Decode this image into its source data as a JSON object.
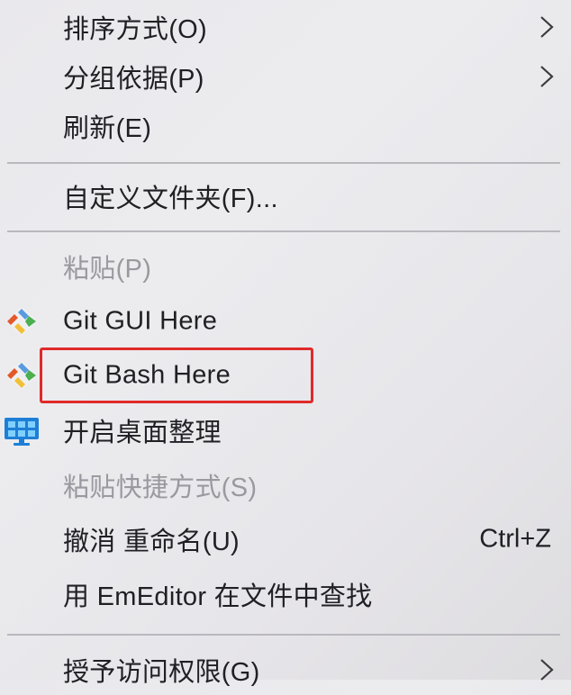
{
  "menu": {
    "items": [
      {
        "label": "排序方式(O)",
        "submenu": true
      },
      {
        "label": "分组依据(P)",
        "submenu": true
      },
      {
        "label": "刷新(E)"
      },
      {
        "label": "自定义文件夹(F)..."
      },
      {
        "label": "粘贴(P)",
        "disabled": true
      },
      {
        "label": "Git GUI Here",
        "icon": "git-icon"
      },
      {
        "label": "Git Bash Here",
        "icon": "git-icon",
        "highlighted": true
      },
      {
        "label": "开启桌面整理",
        "icon": "monitor-icon"
      },
      {
        "label": "粘贴快捷方式(S)",
        "disabled": true
      },
      {
        "label": "撤消 重命名(U)",
        "shortcut": "Ctrl+Z"
      },
      {
        "label": "用 EmEditor 在文件中查找"
      },
      {
        "label": "授予访问权限(G)",
        "submenu": true
      }
    ]
  },
  "colors": {
    "highlight_border": "#e02a2a",
    "disabled_text": "#9a999f",
    "text": "#1f1f24"
  }
}
